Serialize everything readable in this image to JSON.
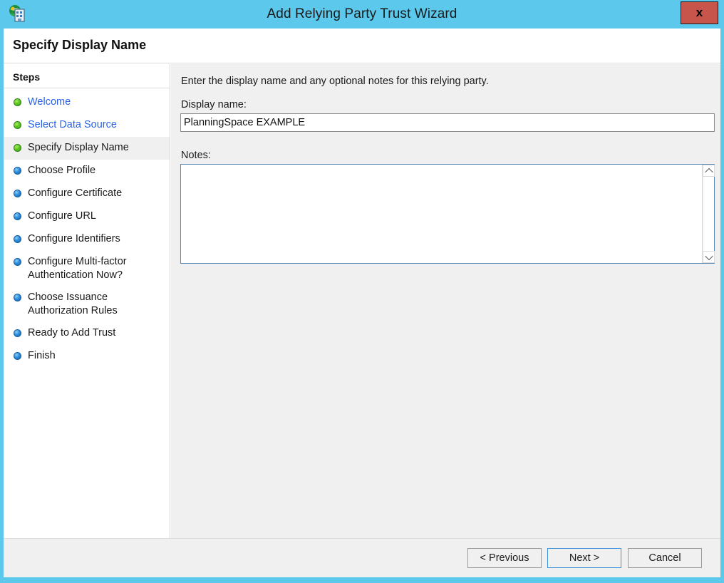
{
  "window": {
    "title": "Add Relying Party Trust Wizard",
    "app_icon": "adfs-relying-party-icon",
    "close_label": "x",
    "accent_color": "#5BC8EC",
    "close_button_color": "#C8554B"
  },
  "header": {
    "title": "Specify Display Name"
  },
  "sidebar": {
    "title": "Steps",
    "items": [
      {
        "label": "Welcome",
        "state": "done",
        "bullet": "green",
        "link": true
      },
      {
        "label": "Select Data Source",
        "state": "done",
        "bullet": "green",
        "link": true
      },
      {
        "label": "Specify Display Name",
        "state": "current",
        "bullet": "green",
        "link": false
      },
      {
        "label": "Choose Profile",
        "state": "pending",
        "bullet": "blue",
        "link": false
      },
      {
        "label": "Configure Certificate",
        "state": "pending",
        "bullet": "blue",
        "link": false
      },
      {
        "label": "Configure URL",
        "state": "pending",
        "bullet": "blue",
        "link": false
      },
      {
        "label": "Configure Identifiers",
        "state": "pending",
        "bullet": "blue",
        "link": false
      },
      {
        "label": "Configure Multi-factor\nAuthentication Now?",
        "state": "pending",
        "bullet": "blue",
        "link": false
      },
      {
        "label": "Choose Issuance\nAuthorization Rules",
        "state": "pending",
        "bullet": "blue",
        "link": false
      },
      {
        "label": "Ready to Add Trust",
        "state": "pending",
        "bullet": "blue",
        "link": false
      },
      {
        "label": "Finish",
        "state": "pending",
        "bullet": "blue",
        "link": false
      }
    ]
  },
  "main": {
    "intro": "Enter the display name and any optional notes for this relying party.",
    "display_name_label": "Display name:",
    "display_name_value": "PlanningSpace EXAMPLE",
    "display_name_placeholder": "",
    "notes_label": "Notes:",
    "notes_value": "",
    "notes_placeholder": "",
    "scrollbar": {
      "up_icon": "chevron-up-icon",
      "down_icon": "chevron-down-icon"
    }
  },
  "footer": {
    "previous_label": "< Previous",
    "next_label": "Next >",
    "cancel_label": "Cancel"
  }
}
